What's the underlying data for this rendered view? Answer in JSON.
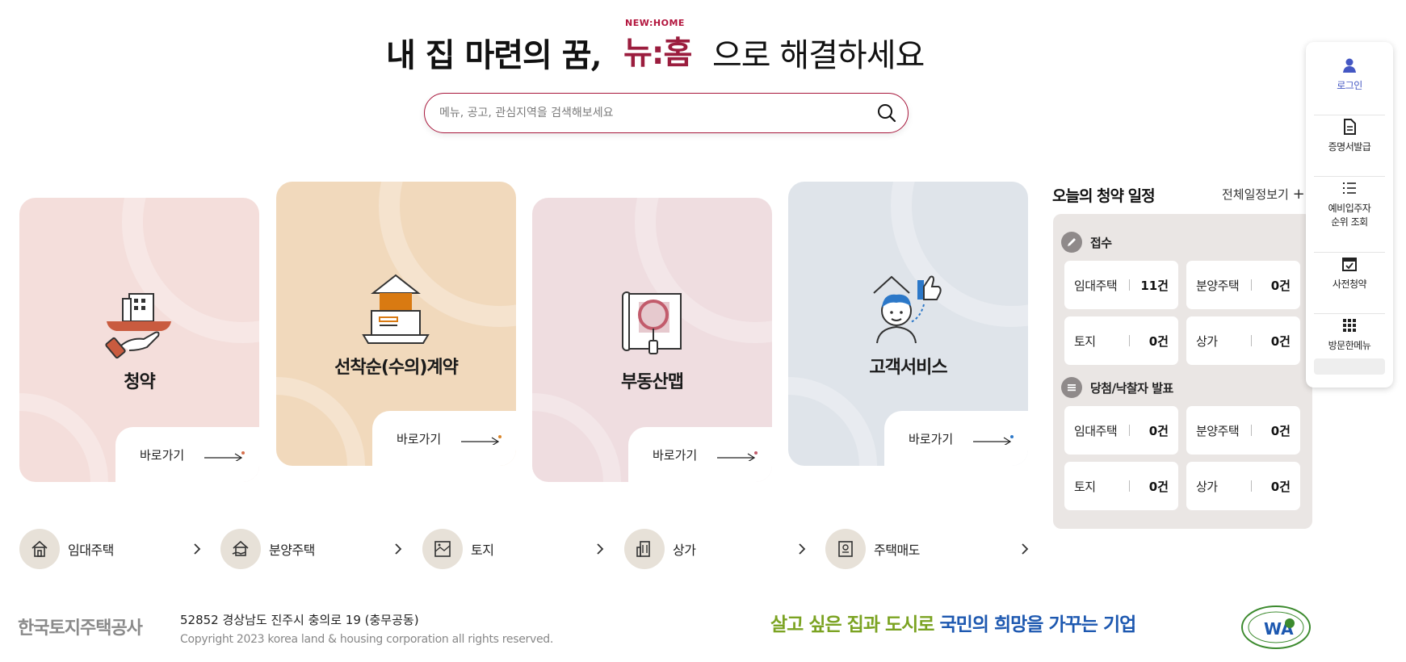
{
  "hero": {
    "lead": "내 집 마련의 꿈,",
    "brand_en": "NEW:HOME",
    "brand_ko": "뉴:홈",
    "tail": "으로 해결하세요"
  },
  "search": {
    "placeholder": "메뉴, 공고, 관심지역을 검색해보세요"
  },
  "cards": [
    {
      "title": "청약",
      "link": "바로가기",
      "bg": "#f4dedb"
    },
    {
      "title": "선착순(수의)계약",
      "link": "바로가기",
      "bg": "#f1d9bc"
    },
    {
      "title": "부동산맵",
      "link": "바로가기",
      "bg": "#efdde0"
    },
    {
      "title": "고객서비스",
      "link": "바로가기",
      "bg": "#dfe4ea"
    }
  ],
  "schedule": {
    "title": "오늘의 청약 일정",
    "view_all": "전체일정보기",
    "sections": [
      {
        "label": "접수",
        "icon": "pencil-icon",
        "items": [
          {
            "label": "임대주택",
            "count": "11건"
          },
          {
            "label": "분양주택",
            "count": "0건"
          },
          {
            "label": "토지",
            "count": "0건"
          },
          {
            "label": "상가",
            "count": "0건"
          }
        ]
      },
      {
        "label": "당첨/낙찰자 발표",
        "icon": "list-icon",
        "items": [
          {
            "label": "임대주택",
            "count": "0건"
          },
          {
            "label": "분양주택",
            "count": "0건"
          },
          {
            "label": "토지",
            "count": "0건"
          },
          {
            "label": "상가",
            "count": "0건"
          }
        ]
      }
    ]
  },
  "quick": [
    {
      "label": "로그인",
      "icon": "user-icon"
    },
    {
      "label": "증명서발급",
      "icon": "document-icon"
    },
    {
      "label": "예비입주자\n순위 조회",
      "label_1": "예비입주자",
      "label_2": "순위 조회",
      "icon": "list-icon"
    },
    {
      "label": "사전청약",
      "icon": "calendar-check-icon"
    },
    {
      "label": "방문한메뉴",
      "icon": "grid-icon"
    }
  ],
  "categories": [
    {
      "label": "임대주택",
      "icon": "house-icon"
    },
    {
      "label": "분양주택",
      "icon": "house-sale-icon"
    },
    {
      "label": "토지",
      "icon": "land-icon"
    },
    {
      "label": "상가",
      "icon": "building-icon"
    },
    {
      "label": "주택매도",
      "icon": "contract-icon"
    }
  ],
  "footer": {
    "logo": "한국토지주택공사",
    "address": "52852 경상남도 진주시 충의로 19 (충무공동)",
    "copyright": "Copyright 2023 korea land & housing corporation all rights reserved.",
    "slogan_green": "살고 싶은 집과 도시로",
    "slogan_blue": "국민의 희망을 가꾸는 기업",
    "wa_mark": "WA"
  },
  "colors": {
    "brand": "#9b1d3e",
    "accent_blue": "#4457c3",
    "panel_bg": "#eae6e4"
  }
}
